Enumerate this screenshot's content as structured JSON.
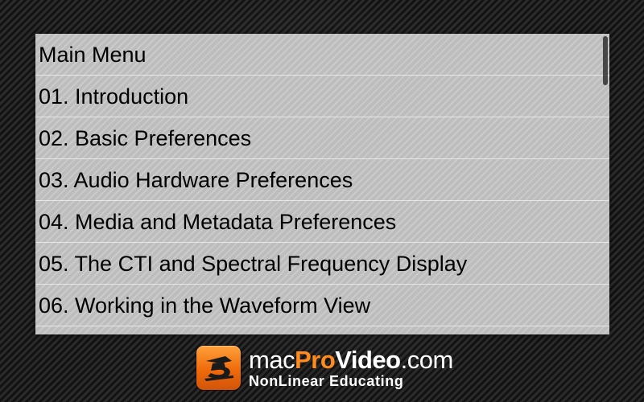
{
  "menu": {
    "items": [
      {
        "label": "Main Menu"
      },
      {
        "label": "01. Introduction"
      },
      {
        "label": "02. Basic Preferences"
      },
      {
        "label": "03. Audio Hardware Preferences"
      },
      {
        "label": "04. Media and Metadata Preferences"
      },
      {
        "label": "05. The CTI and Spectral Frequency Display"
      },
      {
        "label": "06. Working in the Waveform View"
      }
    ]
  },
  "logo": {
    "line1_mac": "mac",
    "line1_pro": "Pro",
    "line1_video": "Video",
    "line1_com": ".com",
    "line2": "NonLinear Educating",
    "icon": "macprovideo-badge-icon",
    "accent_color": "#f47a16"
  },
  "colors": {
    "panel_bg": "#bdbdbd",
    "row_divider": "#e6e6e6",
    "page_bg": "#151515"
  }
}
